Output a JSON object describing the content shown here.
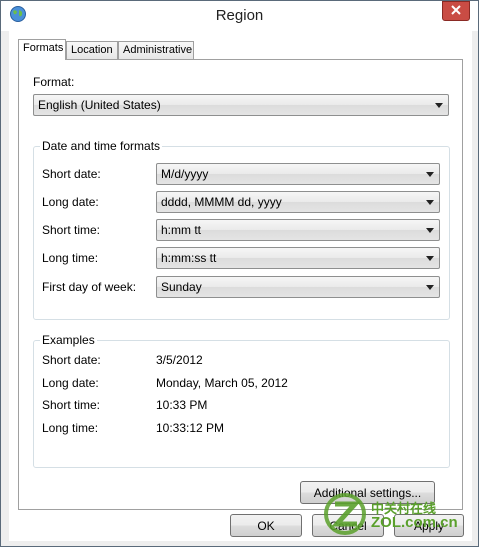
{
  "window": {
    "title": "Region"
  },
  "tabs": [
    "Formats",
    "Location",
    "Administrative"
  ],
  "format": {
    "label": "Format:",
    "value": "English (United States)"
  },
  "date_time_formats": {
    "title": "Date and time formats",
    "rows": [
      {
        "label": "Short date:",
        "value": "M/d/yyyy"
      },
      {
        "label": "Long date:",
        "value": "dddd, MMMM dd, yyyy"
      },
      {
        "label": "Short time:",
        "value": "h:mm tt"
      },
      {
        "label": "Long time:",
        "value": "h:mm:ss tt"
      },
      {
        "label": "First day of week:",
        "value": "Sunday"
      }
    ]
  },
  "examples": {
    "title": "Examples",
    "rows": [
      {
        "label": "Short date:",
        "value": "3/5/2012"
      },
      {
        "label": "Long date:",
        "value": "Monday, March 05, 2012"
      },
      {
        "label": "Short time:",
        "value": "10:33 PM"
      },
      {
        "label": "Long time:",
        "value": "10:33:12 PM"
      }
    ]
  },
  "buttons": {
    "additional": "Additional settings...",
    "ok": "OK",
    "cancel": "Cancel",
    "apply": "Apply"
  },
  "watermark": {
    "chinese": "中关村在线",
    "site": "ZOL.com.cn"
  },
  "colors": {
    "close_button": "#c94c44",
    "watermark_green": "#5aa02c"
  }
}
